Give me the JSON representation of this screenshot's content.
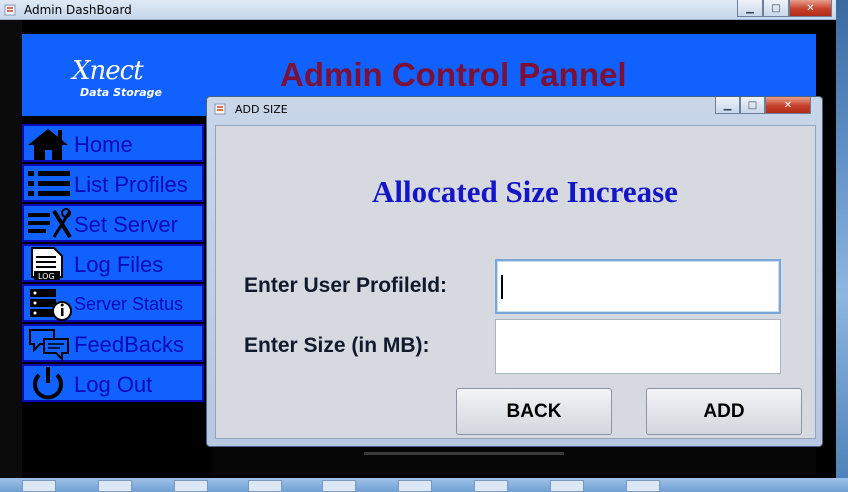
{
  "main_window": {
    "title": "Admin DashBoard",
    "header_title": "Admin Control Pannel",
    "logo": {
      "main": "Xnect",
      "sub": "Data Storage"
    },
    "sidebar": {
      "items": [
        {
          "label": "Home",
          "icon": "home-icon"
        },
        {
          "label": "List Profiles",
          "icon": "list-icon"
        },
        {
          "label": "Set Server",
          "icon": "tools-icon"
        },
        {
          "label": "Log Files",
          "icon": "log-file-icon"
        },
        {
          "label": "Server Status",
          "icon": "server-status-icon"
        },
        {
          "label": "FeedBacks",
          "icon": "feedback-icon"
        },
        {
          "label": "Log Out",
          "icon": "power-icon"
        }
      ]
    }
  },
  "dialog": {
    "title": "ADD SIZE",
    "heading": "Allocated Size Increase",
    "fields": {
      "profile_id": {
        "label": "Enter User ProfileId:",
        "value": ""
      },
      "size": {
        "label": "Enter Size (in MB):",
        "value": ""
      }
    },
    "buttons": {
      "back": "BACK",
      "add": "ADD"
    }
  },
  "colors": {
    "header_blue": "#1161fe",
    "title_maroon": "#7b1138",
    "heading_blue": "#1414c8",
    "nav_text": "#0a0ab8"
  }
}
